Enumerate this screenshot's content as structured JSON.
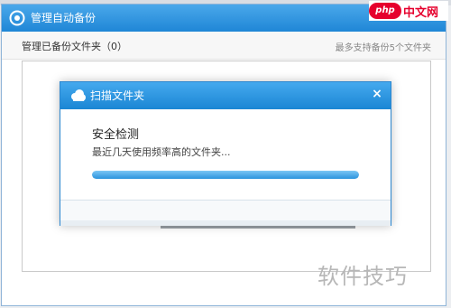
{
  "main_window": {
    "title": "管理自动备份",
    "header": {
      "folder_count": "管理已备份文件夹（0）",
      "max_note": "最多支持备份5个文件夹"
    }
  },
  "dialog": {
    "title": "扫描文件夹",
    "close_label": "×",
    "check_title": "安全检测",
    "check_subtitle": "最近几天使用频率高的文件夹...",
    "progress_fraction": 1.0
  },
  "watermarks": {
    "php_logo": "php",
    "php_text": "中文网",
    "bottom_text": "软件技巧"
  },
  "colors": {
    "title_blue": "#1f86d6",
    "progress_blue": "#2a93dd",
    "php_red": "#e6002d"
  }
}
